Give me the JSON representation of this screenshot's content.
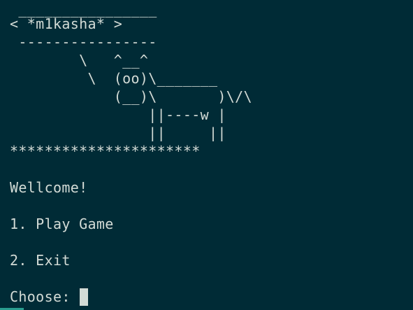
{
  "terminal": {
    "cowsay_lines": [
      " ________________",
      "< *m1kasha* >",
      " ----------------",
      "        \\   ^__^",
      "         \\  (oo)\\_______",
      "            (__)\\       )\\/\\",
      "                ||----w |",
      "                ||     ||"
    ],
    "separator": "**********************",
    "welcome": "Wellcome!",
    "menu": [
      "1. Play Game",
      "2. Exit"
    ],
    "prompt": "Choose: "
  },
  "colors": {
    "background": "#002b36",
    "foreground": "#d3dbd6",
    "cursor": "#d3dbd6",
    "accent": "#2a9d8f"
  }
}
